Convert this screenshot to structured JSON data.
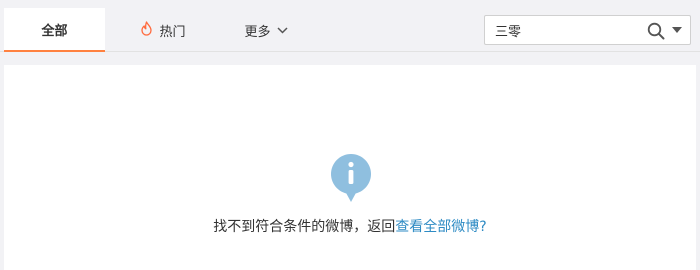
{
  "tabs": {
    "all_label": "全部",
    "hot_label": "热门",
    "more_label": "更多"
  },
  "search": {
    "value": "三零",
    "placeholder": ""
  },
  "empty_state": {
    "message": "找不到符合条件的微博，返回",
    "link_text": "查看全部微博?"
  },
  "colors": {
    "accent": "#ff8140",
    "link": "#2e8bc4",
    "info_icon": "#8fbfdf"
  },
  "icons": {
    "hot": "flame-icon",
    "more": "chevron-down-icon",
    "search": "search-icon",
    "dropdown": "caret-down-icon",
    "empty": "info-icon"
  }
}
